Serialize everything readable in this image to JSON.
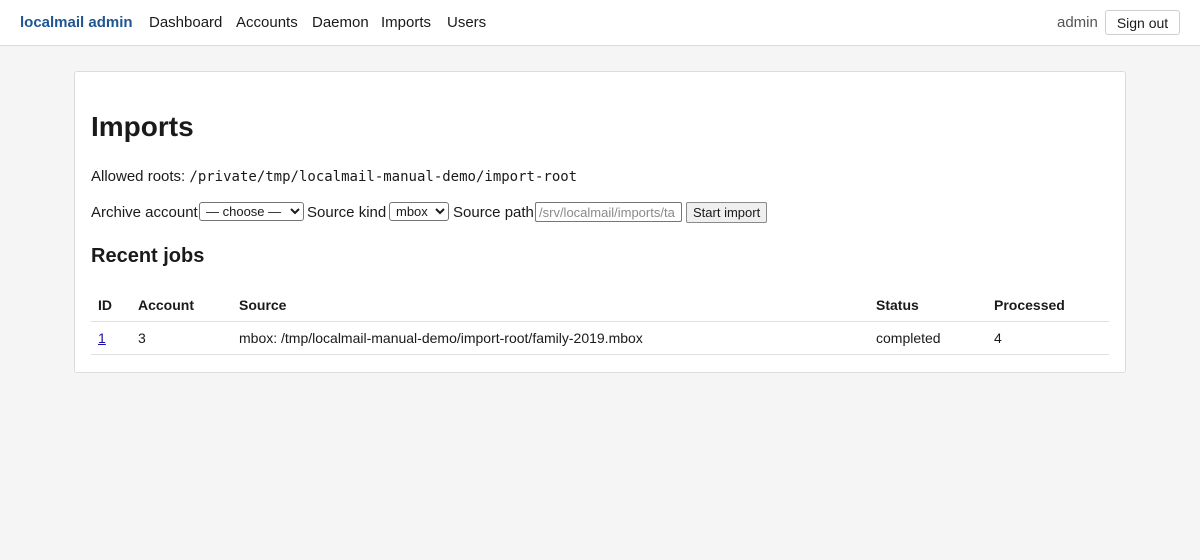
{
  "header": {
    "brand": "localmail admin",
    "nav": [
      "Dashboard",
      "Accounts",
      "Daemon",
      "Imports",
      "Users"
    ],
    "user": "admin",
    "signout_label": "Sign out"
  },
  "page": {
    "title": "Imports",
    "allowed_roots_label": "Allowed roots:",
    "allowed_roots_value": "/private/tmp/localmail-manual-demo/import-root"
  },
  "form": {
    "archive_account_label": "Archive account",
    "archive_account_selected": "— choose —",
    "source_kind_label": "Source kind",
    "source_kind_selected": "mbox",
    "source_path_label": "Source path",
    "source_path_placeholder": "/srv/localmail/imports/ta",
    "source_path_value": "",
    "submit_label": "Start import"
  },
  "recent_jobs": {
    "title": "Recent jobs",
    "columns": [
      "ID",
      "Account",
      "Source",
      "Status",
      "Processed"
    ],
    "rows": [
      {
        "id": "1",
        "account": "3",
        "source": "mbox: /tmp/localmail-manual-demo/import-root/family-2019.mbox",
        "status": "completed",
        "processed": "4"
      }
    ]
  }
}
